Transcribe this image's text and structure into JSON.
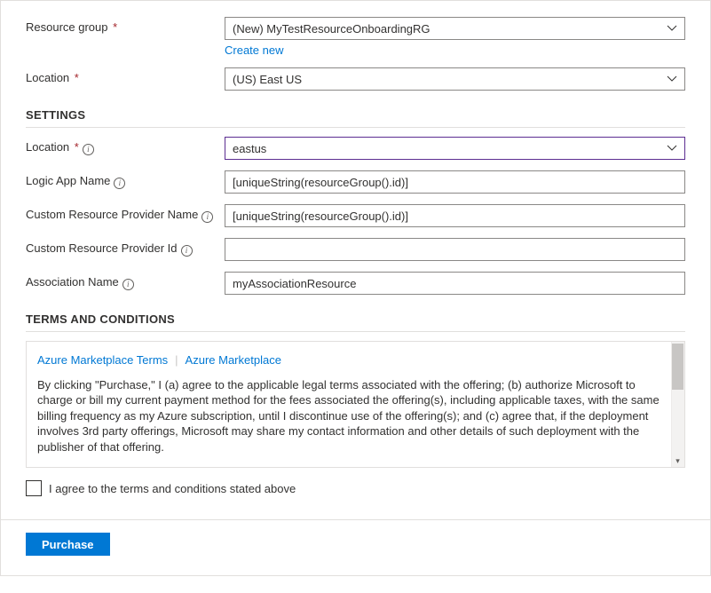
{
  "basics": {
    "resource_group_label": "Resource group",
    "resource_group_value": "(New) MyTestResourceOnboardingRG",
    "create_new": "Create new",
    "location_label": "Location",
    "location_value": "(US) East US"
  },
  "settings": {
    "heading": "SETTINGS",
    "location_label": "Location",
    "location_value": "eastus",
    "logic_app_label": "Logic App Name",
    "logic_app_value": "[uniqueString(resourceGroup().id)]",
    "crp_name_label": "Custom Resource Provider Name",
    "crp_name_value": "[uniqueString(resourceGroup().id)]",
    "crp_id_label": "Custom Resource Provider Id",
    "crp_id_value": "",
    "assoc_name_label": "Association Name",
    "assoc_name_value": "myAssociationResource"
  },
  "terms": {
    "heading": "TERMS AND CONDITIONS",
    "link1": "Azure Marketplace Terms",
    "link2": "Azure Marketplace",
    "body": "By clicking \"Purchase,\" I (a) agree to the applicable legal terms associated with the offering; (b) authorize Microsoft to charge or bill my current payment method for the fees associated the offering(s), including applicable taxes, with the same billing frequency as my Azure subscription, until I discontinue use of the offering(s); and (c) agree that, if the deployment involves 3rd party offerings, Microsoft may share my contact information and other details of such deployment with the publisher of that offering.",
    "agree_label": "I agree to the terms and conditions stated above"
  },
  "footer": {
    "purchase": "Purchase"
  }
}
